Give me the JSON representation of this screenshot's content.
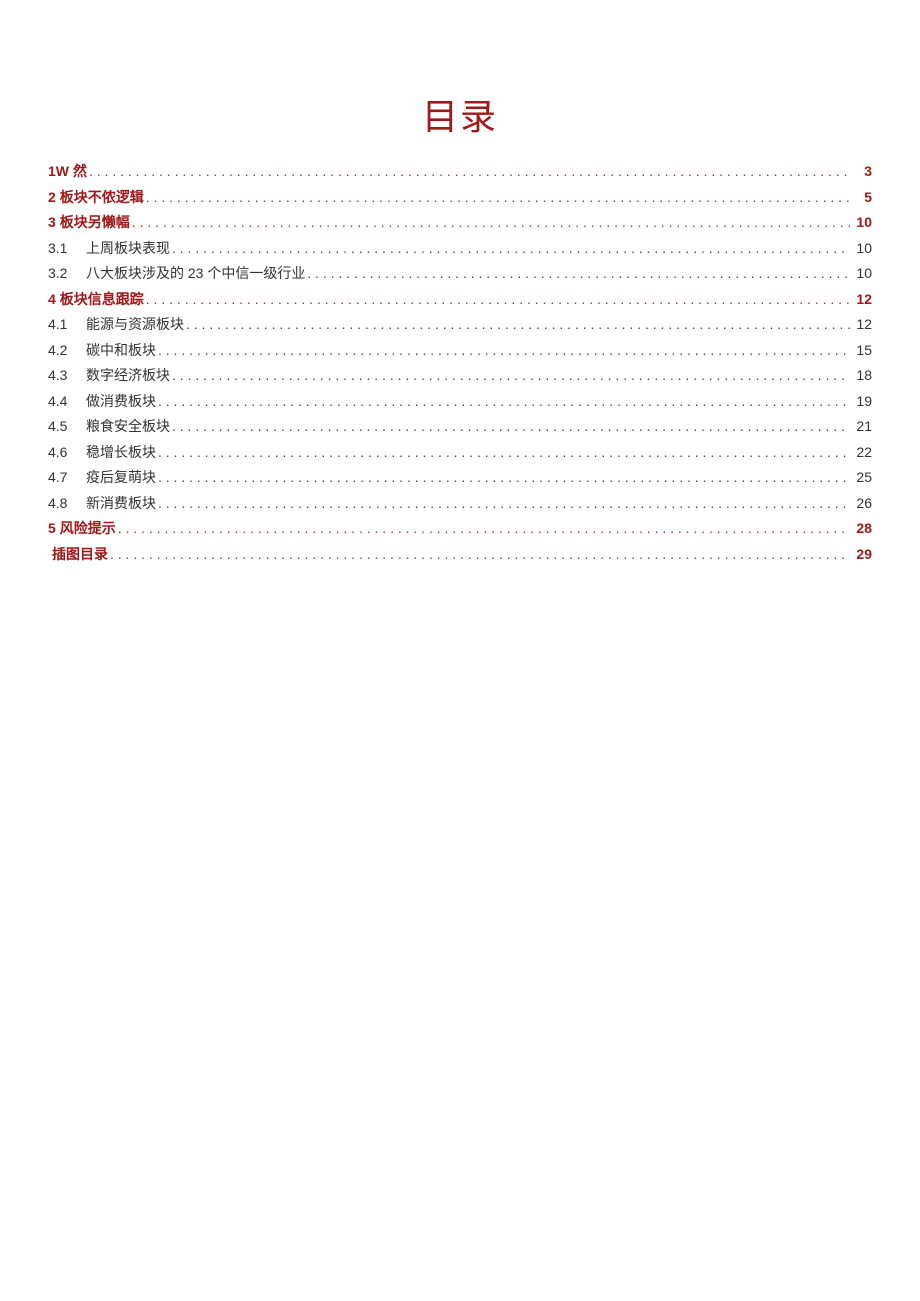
{
  "title": "目录",
  "toc": [
    {
      "level": 1,
      "num": "1W",
      "text": "然",
      "page": "3"
    },
    {
      "level": 1,
      "num": "2",
      "text": "板块不侬逻辑",
      "page": "5"
    },
    {
      "level": 1,
      "num": "3",
      "text": "板块另懒幅",
      "page": "10"
    },
    {
      "level": 2,
      "num": "3.1",
      "text": "上周板块表现",
      "page": "10"
    },
    {
      "level": 2,
      "num": "3.2",
      "text": "八大板块涉及的 23 个中信一级行业",
      "page": "10"
    },
    {
      "level": 1,
      "num": "4",
      "text": "板块信息跟踪",
      "page": "12"
    },
    {
      "level": 2,
      "num": "4.1",
      "text": "能源与资源板块",
      "page": "12"
    },
    {
      "level": 2,
      "num": "4.2",
      "text": "碳中和板块",
      "page": "15"
    },
    {
      "level": 2,
      "num": "4.3",
      "text": "数字经济板块",
      "page": "18"
    },
    {
      "level": 2,
      "num": "4.4",
      "text": "做消费板块",
      "page": "19"
    },
    {
      "level": 2,
      "num": "4.5",
      "text": "粮食安全板块",
      "page": "21"
    },
    {
      "level": 2,
      "num": "4.6",
      "text": "稳增长板块",
      "page": "22"
    },
    {
      "level": 2,
      "num": "4.7",
      "text": "疫后复萌块",
      "page": "25"
    },
    {
      "level": 2,
      "num": "4.8",
      "text": "新消费板块",
      "page": "26"
    },
    {
      "level": 1,
      "num": "5",
      "text": "风险提示",
      "page": "28"
    },
    {
      "level": 1,
      "num": "",
      "text": "插图目录",
      "page": "29"
    }
  ]
}
